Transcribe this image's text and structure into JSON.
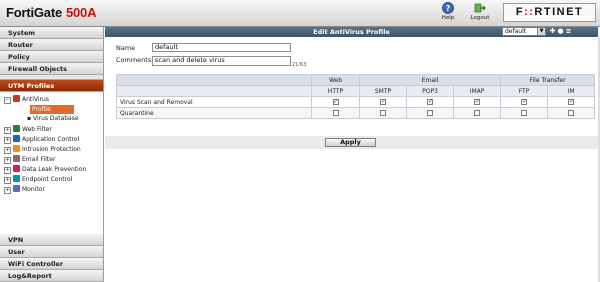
{
  "header": {
    "product": "FortiGate",
    "model": "500A",
    "help_label": "Help",
    "logout_label": "Logout",
    "logo_left": "F",
    "logo_red": "::",
    "logo_right": "RTINET"
  },
  "sidebar": {
    "top_items": [
      {
        "label": "System"
      },
      {
        "label": "Router"
      },
      {
        "label": "Policy"
      },
      {
        "label": "Firewall Objects"
      },
      {
        "label": "UTM Profiles",
        "active": true
      }
    ],
    "tree": [
      {
        "label": "AntiVirus",
        "expand": "−",
        "icon_color": "#c0392b"
      },
      {
        "label": "Web Filter",
        "expand": "+",
        "icon_color": "#2e7d32"
      },
      {
        "label": "Application Control",
        "expand": "+",
        "icon_color": "#1565c0"
      },
      {
        "label": "Intrusion Protection",
        "expand": "+",
        "icon_color": "#ef8f1c"
      },
      {
        "label": "Email Filter",
        "expand": "+",
        "icon_color": "#8d6e63"
      },
      {
        "label": "Data Leak Prevention",
        "expand": "+",
        "icon_color": "#d81b60"
      },
      {
        "label": "Endpoint Control",
        "expand": "+",
        "icon_color": "#0097a7"
      },
      {
        "label": "Monitor",
        "expand": "+",
        "icon_color": "#5c6bc0"
      }
    ],
    "antivirus_sub": [
      {
        "label": "Profile",
        "selected": true
      },
      {
        "label": "Virus Database"
      }
    ],
    "bottom_items": [
      {
        "label": "VPN"
      },
      {
        "label": "User"
      },
      {
        "label": "WiFi Controller"
      },
      {
        "label": "Log&Report"
      }
    ]
  },
  "content": {
    "title": "Edit AntiVirus Profile",
    "profile_selected": "default",
    "name_label": "Name",
    "name_value": "default",
    "comments_label": "Comments",
    "comments_value": "scan and delete virus",
    "counter": "21/63",
    "groups": [
      "Web",
      "Email",
      "File Transfer"
    ],
    "protocols": [
      "HTTP",
      "SMTP",
      "POP3",
      "IMAP",
      "FTP",
      "IM"
    ],
    "rows": [
      {
        "label": "Virus Scan and Removal",
        "checks": [
          true,
          true,
          true,
          true,
          true,
          true
        ]
      },
      {
        "label": "Quarantine",
        "checks": [
          false,
          false,
          false,
          false,
          false,
          false
        ]
      }
    ],
    "apply_label": "Apply"
  }
}
